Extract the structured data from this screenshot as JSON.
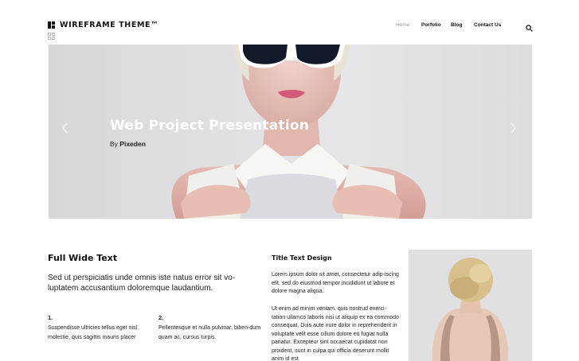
{
  "header": {
    "logo_text": "WIREFRAME THEME™",
    "nav": {
      "home": "Home",
      "portfolio": "Porfolio",
      "blog": "Blog",
      "contact": "Contact Us"
    }
  },
  "hero": {
    "title": "Web Project Presentation",
    "by_prefix": "By",
    "author": "Pixeden"
  },
  "content": {
    "full_title": "Full Wide Text",
    "full_lead": "Sed ut perspiciatis unde omnis iste natus error sit vo-luptatem accusantium doloremque laudantium.",
    "columns": [
      {
        "num": "1.",
        "text": "Suspendisse ultricies tellus eget nisl molestie, quis sagittis mauris placer"
      },
      {
        "num": "2.",
        "text": "Pellentesque et nulla pulvinar, biben-dum quam ac, cursus turpis."
      }
    ],
    "side_title": "Title Text Design",
    "side_p1": "Lorem ipsum dolor sit amet, consectetur adip-iscing elit, sed do eiusmod tempor incididunt ut labore et dolore magna aliqua.",
    "side_p2": "Ut enim ad minim veniam, quis nostrud exerci-tation ullamco laboris nisi ut aliquip ex ea commodo consequat. Duis aute irure dolor in reprehenderit in voluptate velit esse cillum dolore eu fugiat nulla pariatur. Excepteur sint occaecat cupidatat non proident, sunt in culpa qui officia deserunt mollit anim id est"
  },
  "icons": {
    "logo": "logo-grid-icon",
    "grid": "grid-icon",
    "search": "search-icon",
    "prev": "chevron-left-icon",
    "next": "chevron-right-icon"
  },
  "colors": {
    "text": "#111111",
    "nav_active": "#999999",
    "hero_title": "#ffffff"
  }
}
